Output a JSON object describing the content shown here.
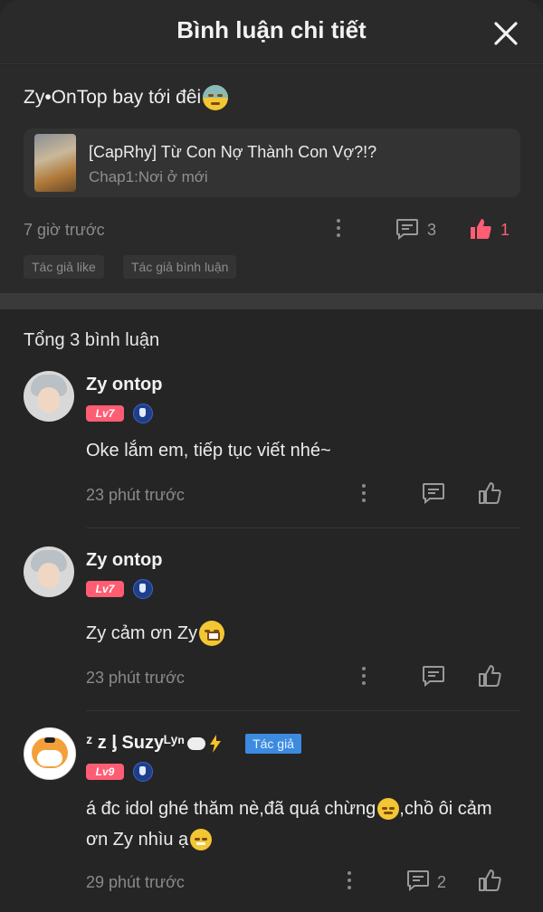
{
  "header": {
    "title": "Bình luận chi tiết"
  },
  "post": {
    "text": "Zy•OnTop bay tới đêi",
    "chapter": {
      "title": "[CapRhy] Từ Con Nợ Thành Con Vợ?!?",
      "subtitle": "Chap1:Nơi ở mới"
    },
    "time": "7 giờ trước",
    "reply_count": "3",
    "like_count": "1",
    "tags": [
      "Tác giả like",
      "Tác giả bình luận"
    ]
  },
  "comments_total": "Tổng 3 bình luận",
  "comments": [
    {
      "user": "Zy ontop",
      "level": "Lv7",
      "text": "Oke lắm em, tiếp tục viết nhé~",
      "time": "23 phút trước"
    },
    {
      "user": "Zy ontop",
      "level": "Lv7",
      "text": "Zy cảm ơn Zy",
      "time": "23 phút trước"
    },
    {
      "user": "ᶻ z ᶅ Suzyᴸʸⁿ",
      "author_badge": "Tác giả",
      "level": "Lv9",
      "text_line1": "á đc idol ghé thăm nè,đã quá chừng",
      "text_line1b": ",chồ ôi cảm",
      "text_line2": "ơn Zy nhìu ạ",
      "time": "29 phút trước",
      "reply_count": "2"
    }
  ],
  "colors": {
    "accent_like": "#ff5d73",
    "author_tag": "#3c8be0",
    "background": "#252525"
  }
}
